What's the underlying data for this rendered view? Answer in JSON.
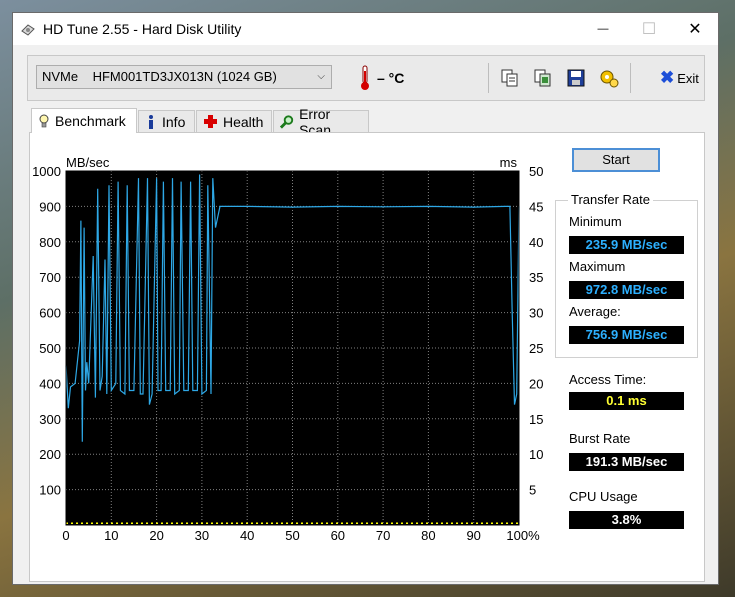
{
  "window": {
    "title": "HD Tune 2.55 - Hard Disk Utility",
    "minimize_glyph": "—",
    "maximize_glyph": "☐",
    "close_glyph": "✕"
  },
  "toolbar": {
    "drive": "NVMe    HFM001TD3JX013N (1024 GB)",
    "temperature": "– °C",
    "exit_label": "Exit",
    "icons": [
      "copy-text-icon",
      "copy-screenshot-icon",
      "save-icon",
      "options-icon",
      "exit-icon"
    ]
  },
  "tabs": [
    {
      "label": "Benchmark",
      "icon": "lightbulb-icon",
      "active": true
    },
    {
      "label": "Info",
      "icon": "info-icon",
      "active": false
    },
    {
      "label": "Health",
      "icon": "health-cross-icon",
      "active": false
    },
    {
      "label": "Error Scan",
      "icon": "magnifier-icon",
      "active": false
    }
  ],
  "benchmark": {
    "start_label": "Start",
    "transfer_rate_title": "Transfer Rate",
    "minimum_label": "Minimum",
    "minimum_value": "235.9 MB/sec",
    "maximum_label": "Maximum",
    "maximum_value": "972.8 MB/sec",
    "average_label": "Average:",
    "average_value": "756.9 MB/sec",
    "access_time_label": "Access Time:",
    "access_time_value": "0.1 ms",
    "burst_rate_label": "Burst Rate",
    "burst_rate_value": "191.3 MB/sec",
    "cpu_usage_label": "CPU Usage",
    "cpu_usage_value": "3.8%"
  },
  "colors": {
    "plot_background": "#000000",
    "grid": "#808080",
    "transfer_line": "#2ea8e6",
    "access_points": "#ffff00",
    "value_blue": "#2db0ff",
    "value_yellow": "#ffff33"
  },
  "chart_data": {
    "type": "line",
    "ylabel": "MB/sec",
    "y2label": "ms",
    "ylim": [
      0,
      1000
    ],
    "y2lim": [
      0,
      50
    ],
    "xlim": [
      0,
      100
    ],
    "yticks": [
      100,
      200,
      300,
      400,
      500,
      600,
      700,
      800,
      900,
      1000
    ],
    "y2ticks": [
      5,
      10,
      15,
      20,
      25,
      30,
      35,
      40,
      45,
      50
    ],
    "xticks": [
      "0",
      "10",
      "20",
      "30",
      "40",
      "50",
      "60",
      "70",
      "80",
      "90",
      "100%"
    ],
    "grid": true,
    "series": [
      {
        "x": [
          0,
          0.5,
          1,
          2,
          3,
          3.3,
          3.6,
          4,
          4.3,
          4.6,
          5,
          6,
          6.5,
          7,
          7.5,
          8,
          8.6,
          9,
          9.5,
          10,
          11,
          11.5,
          12,
          13,
          13.5,
          14,
          15,
          16,
          16.4,
          17,
          18,
          18.4,
          19,
          20,
          20.3,
          21,
          21.5,
          22,
          23,
          23.5,
          24,
          25,
          25.4,
          26,
          27,
          27.5,
          28,
          29,
          29.5,
          30,
          31,
          31.3,
          32,
          32.4,
          33,
          34,
          40,
          50,
          60,
          70,
          80,
          90,
          97,
          98,
          98.5,
          99,
          99.5,
          100
        ],
        "values": [
          450,
          330,
          390,
          400,
          520,
          860,
          235,
          840,
          380,
          460,
          400,
          760,
          360,
          950,
          380,
          420,
          750,
          370,
          960,
          380,
          400,
          970,
          380,
          370,
          960,
          380,
          380,
          980,
          370,
          370,
          980,
          340,
          370,
          980,
          380,
          380,
          970,
          380,
          380,
          980,
          370,
          380,
          970,
          380,
          380,
          970,
          380,
          380,
          990,
          370,
          380,
          960,
          370,
          980,
          840,
          900,
          900,
          898,
          900,
          899,
          900,
          898,
          900,
          900,
          600,
          340,
          370,
          900
        ]
      },
      {
        "x": [
          0,
          10,
          20,
          30,
          40,
          50,
          60,
          70,
          80,
          90,
          100
        ],
        "values": [
          0.1,
          0.1,
          0.1,
          0.1,
          0.1,
          0.1,
          0.1,
          0.1,
          0.1,
          0.1,
          0.1
        ]
      }
    ]
  }
}
